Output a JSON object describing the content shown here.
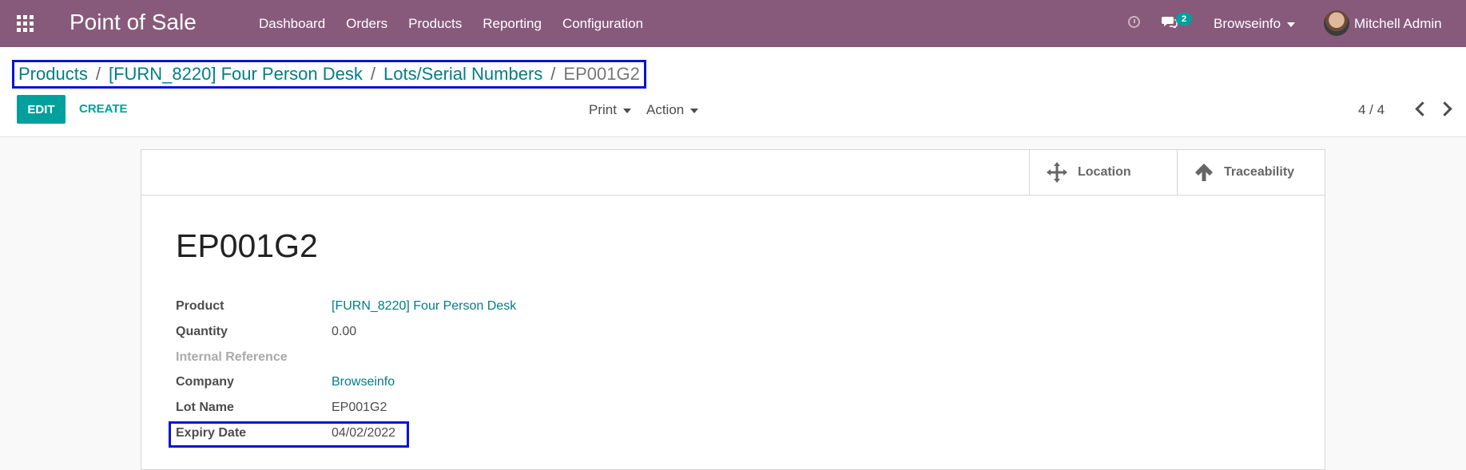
{
  "navbar": {
    "app_title": "Point of Sale",
    "menu": [
      "Dashboard",
      "Orders",
      "Products",
      "Reporting",
      "Configuration"
    ],
    "messages_count": "2",
    "company": "Browseinfo",
    "user": "Mitchell Admin"
  },
  "breadcrumb": {
    "items": [
      "Products",
      "[FURN_8220] Four Person Desk",
      "Lots/Serial Numbers"
    ],
    "current": "EP001G2"
  },
  "toolbar": {
    "edit_label": "EDIT",
    "create_label": "CREATE",
    "print_label": "Print",
    "action_label": "Action",
    "pager": "4 / 4"
  },
  "smart_buttons": {
    "location_label": "Location",
    "traceability_label": "Traceability"
  },
  "record": {
    "title": "EP001G2",
    "fields": {
      "product": {
        "label": "Product",
        "value": "[FURN_8220] Four Person Desk"
      },
      "quantity": {
        "label": "Quantity",
        "value": "0.00"
      },
      "internal_reference": {
        "label": "Internal Reference",
        "value": ""
      },
      "company": {
        "label": "Company",
        "value": "Browseinfo"
      },
      "lot_name": {
        "label": "Lot Name",
        "value": "EP001G2"
      },
      "expiry_date": {
        "label": "Expiry Date",
        "value": "04/02/2022"
      }
    }
  },
  "colors": {
    "navbar": "#875a7b",
    "accent": "#00a09d",
    "link": "#017e84",
    "highlight_border": "#0a12d8"
  },
  "icons": [
    "apps-grid-icon",
    "activity-clock-icon",
    "chat-bubble-icon",
    "caret-down-icon",
    "chevron-left-icon",
    "chevron-right-icon",
    "arrows-move-icon",
    "arrow-up-icon"
  ]
}
